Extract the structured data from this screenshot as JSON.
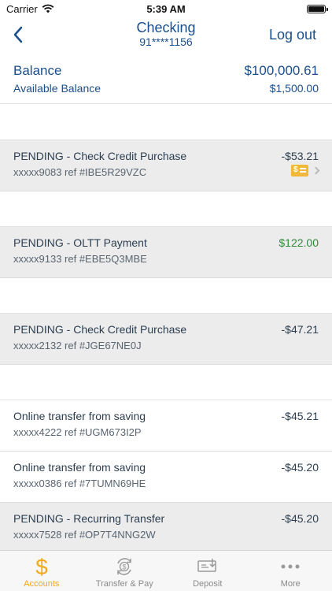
{
  "status_bar": {
    "carrier": "Carrier",
    "time": "5:39 AM"
  },
  "nav": {
    "title": "Checking",
    "subtitle": "91****1156",
    "logout_label": "Log out"
  },
  "balance": {
    "label": "Balance",
    "value": "$100,000.61",
    "available_label": "Available Balance",
    "available_value": "$1,500.00"
  },
  "transactions": [
    {
      "description": "PENDING - Check Credit Purchase",
      "ref": "xxxxx9083 ref #IBE5R29VZC",
      "amount": "-$53.21"
    },
    {
      "description": "PENDING - OLTT Payment",
      "ref": "xxxxx9133 ref #EBE5Q3MBE",
      "amount": "$122.00"
    },
    {
      "description": "PENDING - Check Credit Purchase",
      "ref": "xxxxx2132 ref #JGE67NE0J",
      "amount": "-$47.21"
    },
    {
      "description": "Online transfer from saving",
      "ref": "xxxxx4222 ref #UGM673I2P",
      "amount": "-$45.21"
    },
    {
      "description": "Online transfer from saving",
      "ref": "xxxxx0386 ref #7TUMN69HE",
      "amount": "-$45.20"
    },
    {
      "description": "PENDING - Recurring Transfer",
      "ref": "xxxxx7528 ref #OP7T4NNG2W",
      "amount": "-$45.20"
    }
  ],
  "tabs": [
    {
      "label": "Accounts",
      "icon": "dollar-icon",
      "active": true
    },
    {
      "label": "Transfer & Pay",
      "icon": "transfer-icon",
      "active": false
    },
    {
      "label": "Deposit",
      "icon": "deposit-icon",
      "active": false
    },
    {
      "label": "More",
      "icon": "more-icon",
      "active": false
    }
  ],
  "colors": {
    "brand_blue": "#1b4f8c",
    "accent_gold": "#f3a91d",
    "positive_green": "#2e8b3a",
    "pending_bg": "#ececec"
  }
}
